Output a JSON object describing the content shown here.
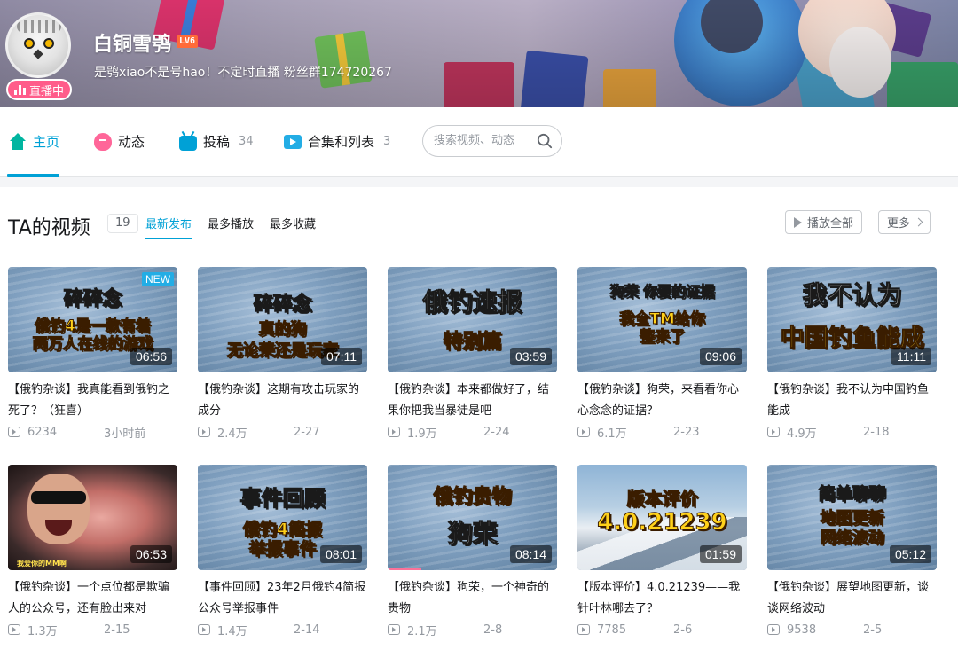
{
  "profile": {
    "name": "白铜雪鸮",
    "level": "LV6",
    "sign": "是鸮xiao不是号hao！不定时直播 粉丝群174720267",
    "live_label": "直播中"
  },
  "nav": {
    "items": [
      {
        "label": "主页",
        "count": "",
        "icon": "home-icon"
      },
      {
        "label": "动态",
        "count": "",
        "icon": "dynamic-icon"
      },
      {
        "label": "投稿",
        "count": "34",
        "icon": "tv-icon"
      },
      {
        "label": "合集和列表",
        "count": "3",
        "icon": "collection-icon"
      }
    ],
    "search_placeholder": "搜索视频、动态"
  },
  "videos_section": {
    "title": "TA的视频",
    "count": "19",
    "tabs": [
      "最新发布",
      "最多播放",
      "最多收藏"
    ],
    "play_all": "播放全部",
    "more": "更多"
  },
  "videos": [
    {
      "thumb_lines": [
        "碎碎念",
        "俄钓4是一款有着",
        "两万人在线的游戏"
      ],
      "duration": "06:56",
      "badge": "NEW",
      "title": "【俄钓杂谈】我真能看到俄钓之死了？（狂喜）",
      "views": "6234",
      "date": "3小时前"
    },
    {
      "thumb_lines": [
        "碎碎念",
        "真的狗",
        "无论荣还是玩家"
      ],
      "duration": "07:11",
      "title": "【俄钓杂谈】这期有攻击玩家的成分",
      "views": "2.4万",
      "date": "2-27"
    },
    {
      "thumb_lines": [
        "俄钓速报",
        "特别篇"
      ],
      "duration": "03:59",
      "title": "【俄钓杂谈】本来都做好了，结果你把我当暴徒是吧",
      "views": "1.9万",
      "date": "2-24"
    },
    {
      "thumb_lines": [
        "狗荣 你要的证据",
        "我全TM给你",
        "整来了"
      ],
      "duration": "09:06",
      "title": "【俄钓杂谈】狗荣，来看看你心心念念的证据？",
      "views": "6.1万",
      "date": "2-23"
    },
    {
      "thumb_lines": [
        "我不认为",
        "中国钓鱼能成"
      ],
      "duration": "11:11",
      "title": "【俄钓杂谈】我不认为中国钓鱼能成",
      "views": "4.9万",
      "date": "2-18"
    },
    {
      "thumb_lines": [
        "",
        "",
        "我爱你的MM啊"
      ],
      "duration": "06:53",
      "title": "【俄钓杂谈】一个点位都是欺骗人的公众号，还有脸出来对",
      "views": "1.3万",
      "date": "2-15"
    },
    {
      "thumb_lines": [
        "事件回顾",
        "俄钓4简报",
        "举报事件"
      ],
      "duration": "08:01",
      "title": "【事件回顾】23年2月俄钓4简报公众号举报事件",
      "views": "1.4万",
      "date": "2-14"
    },
    {
      "thumb_lines": [
        "俄钓贵物",
        "狗荣"
      ],
      "duration": "08:14",
      "title": "【俄钓杂谈】狗荣，一个神奇的贵物",
      "views": "2.1万",
      "date": "2-8"
    },
    {
      "thumb_lines": [
        "版本评价",
        "4.0.21239"
      ],
      "duration": "01:59",
      "title": "【版本评价】4.0.21239——我针叶林哪去了？",
      "views": "7785",
      "date": "2-6"
    },
    {
      "thumb_lines": [
        "简单聊聊",
        "地图更新",
        "网络波动"
      ],
      "duration": "05:12",
      "title": "【俄钓杂谈】展望地图更新，谈谈网络波动",
      "views": "9538",
      "date": "2-5"
    }
  ]
}
